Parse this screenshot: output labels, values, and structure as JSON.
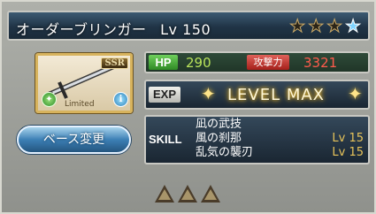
{
  "header": {
    "weapon_name": "オーダーブリンガー",
    "level_text": "Lv 150",
    "stars": [
      {
        "icon": "star-empty",
        "filled": false
      },
      {
        "icon": "star-empty",
        "filled": false
      },
      {
        "icon": "star-empty",
        "filled": false
      },
      {
        "icon": "star-blue",
        "filled": true
      }
    ]
  },
  "card": {
    "rarity": "SSR",
    "tag": "Limited",
    "element_icon": "wind-icon",
    "info_icon": "info-icon"
  },
  "stats": {
    "hp_label": "HP",
    "hp_value": "290",
    "atk_label": "攻撃力",
    "atk_value": "3321"
  },
  "exp": {
    "label": "EXP",
    "status": "LEVEL MAX"
  },
  "base_button": {
    "label": "ベース変更"
  },
  "skill": {
    "label": "SKILL",
    "items": [
      {
        "name": "凪の武技",
        "level": ""
      },
      {
        "name": "風の刹那",
        "level": "Lv 15"
      },
      {
        "name": "乱気の襲刃",
        "level": "Lv 15"
      }
    ]
  },
  "uncap": {
    "count": 3,
    "icon": "uncap-triangle-icon"
  },
  "colors": {
    "header_bg": "#203446",
    "hp_value": "#b8e25a",
    "atk_value": "#ff5b4c",
    "skill_level": "#e8c45a",
    "accent_blue": "#3c7fb5"
  }
}
